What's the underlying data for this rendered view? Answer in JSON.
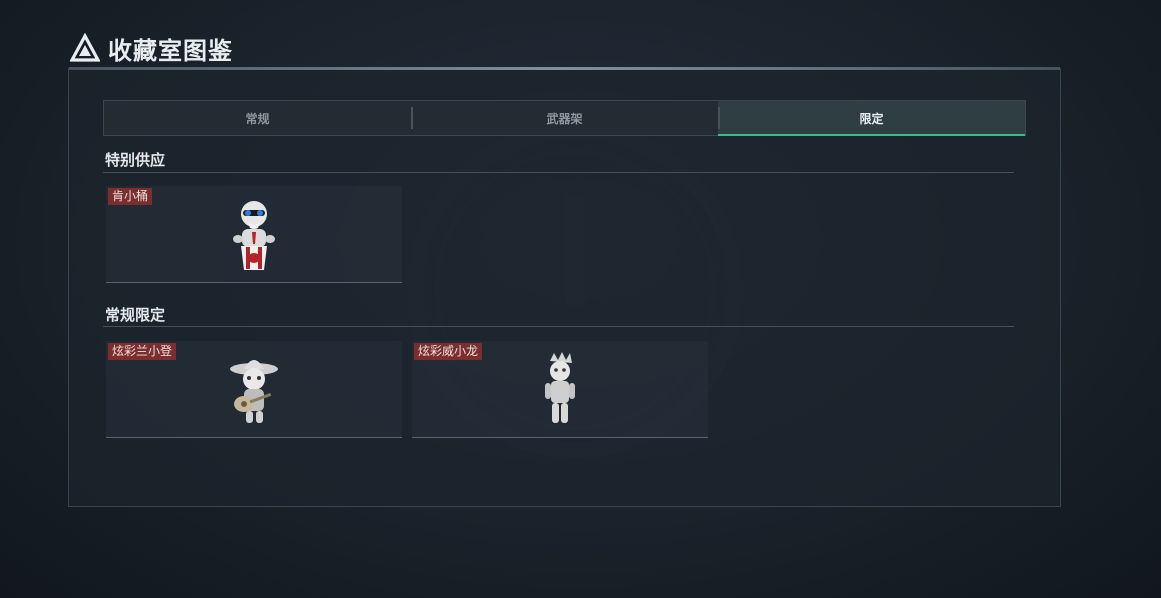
{
  "header": {
    "title": "收藏室图鉴",
    "icon": "triangle-logo-icon"
  },
  "tabs": [
    {
      "label": "常规",
      "active": false
    },
    {
      "label": "武器架",
      "active": false
    },
    {
      "label": "限定",
      "active": true
    }
  ],
  "colors": {
    "accent": "#3fb98b",
    "tag_bg": "#7b2e2e"
  },
  "sections": [
    {
      "title": "特别供应",
      "items": [
        {
          "name": "肯小桶",
          "icon": "colonel-bucket-figure-icon"
        }
      ]
    },
    {
      "title": "常规限定",
      "items": [
        {
          "name": "炫彩兰小登",
          "icon": "sombrero-guitar-figure-icon"
        },
        {
          "name": "炫彩威小龙",
          "icon": "crowned-figure-icon"
        }
      ]
    }
  ]
}
